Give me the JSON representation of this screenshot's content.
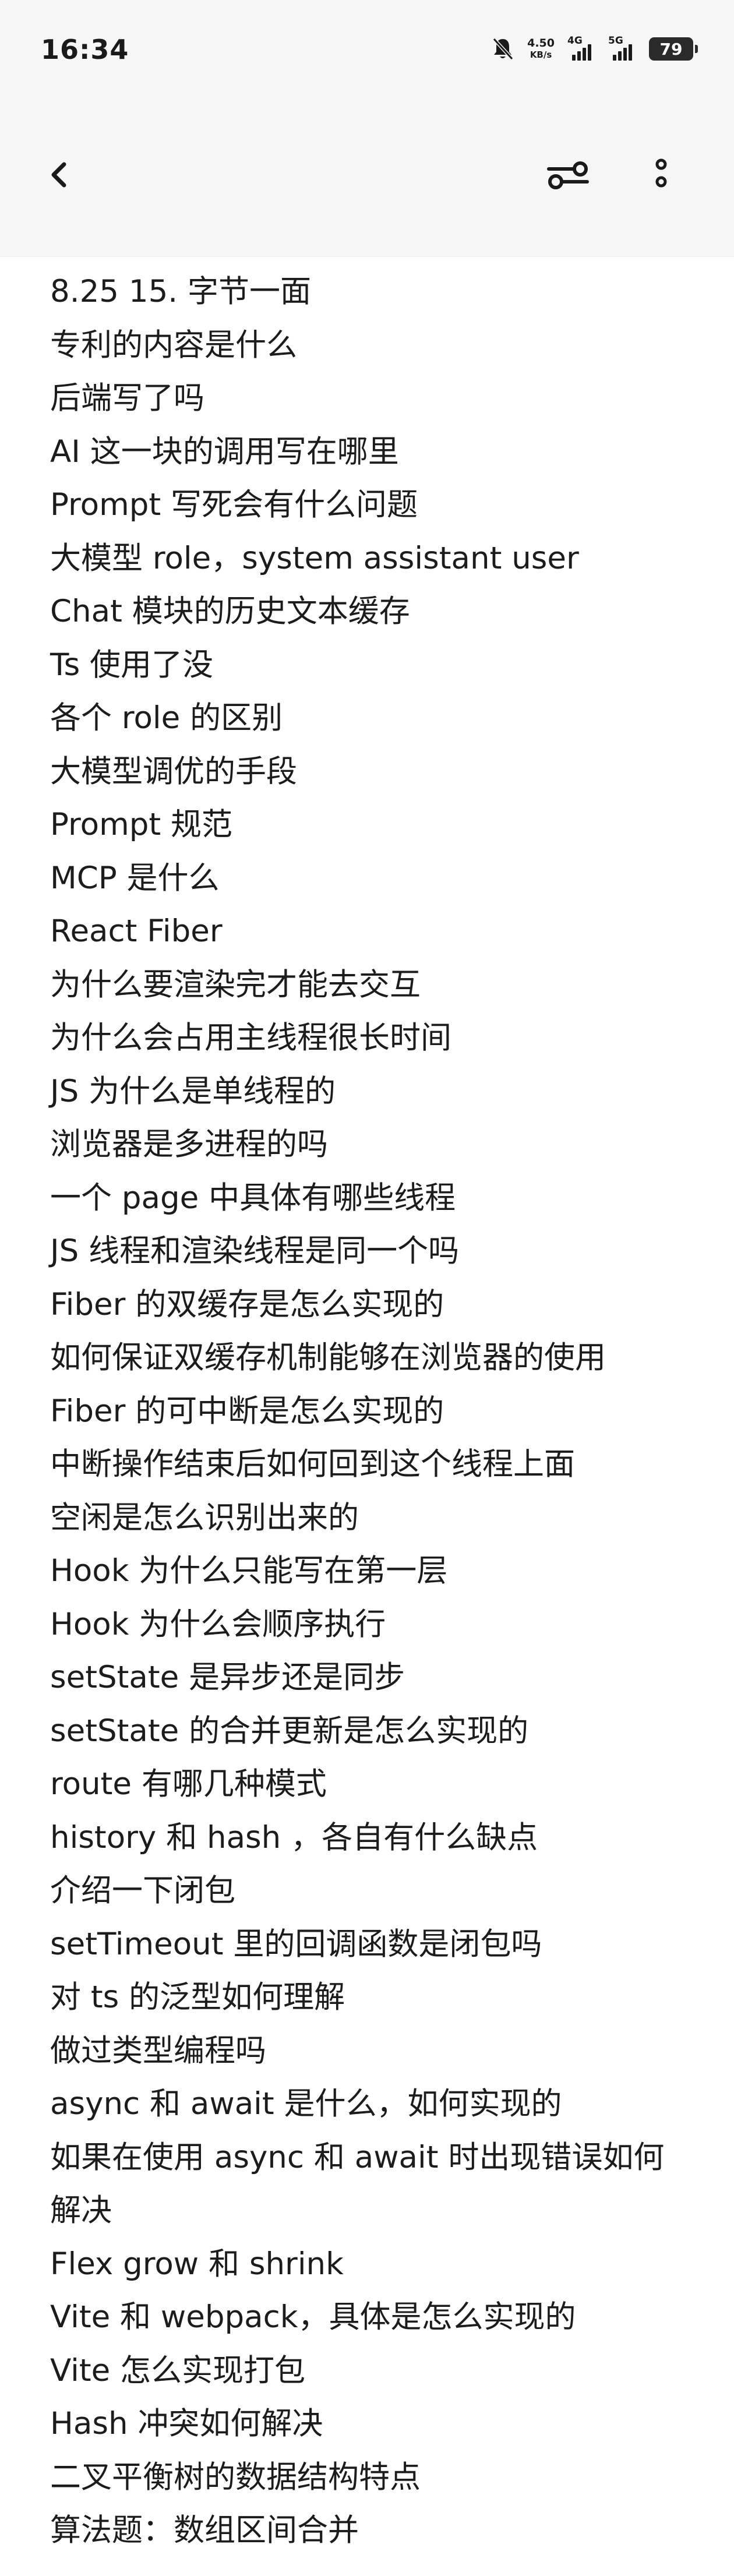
{
  "status_bar": {
    "time": "16:34",
    "speed_value": "4.50",
    "speed_unit": "KB/s",
    "signal_1_label": "4G",
    "signal_2_label": "5G",
    "battery": "79"
  },
  "nav": {
    "back_icon": "chevron-left-icon",
    "filter_icon": "filter-toggle-icon",
    "more_icon": "more-vertical-icon"
  },
  "note": {
    "lines": [
      "8.25 15. 字节一面",
      "专利的内容是什么",
      "后端写了吗",
      "AI 这一块的调用写在哪里",
      "Prompt 写死会有什么问题",
      "大模型 role，system assistant user",
      "Chat 模块的历史文本缓存",
      "Ts 使用了没",
      "各个 role 的区别",
      "大模型调优的手段",
      "Prompt 规范",
      "MCP 是什么",
      "React Fiber",
      "为什么要渲染完才能去交互",
      "为什么会占用主线程很长时间",
      "JS 为什么是单线程的",
      "浏览器是多进程的吗",
      "一个 page 中具体有哪些线程",
      "JS 线程和渲染线程是同一个吗",
      "Fiber 的双缓存是怎么实现的",
      "如何保证双缓存机制能够在浏览器的使用",
      "Fiber 的可中断是怎么实现的",
      "中断操作结束后如何回到这个线程上面",
      "空闲是怎么识别出来的",
      "Hook 为什么只能写在第一层",
      "Hook 为什么会顺序执行",
      "setState 是异步还是同步",
      "setState 的合并更新是怎么实现的",
      "route 有哪几种模式",
      "history 和 hash ，各自有什么缺点",
      "介绍一下闭包",
      "setTimeout 里的回调函数是闭包吗",
      "对 ts 的泛型如何理解",
      "做过类型编程吗",
      "async 和 await 是什么，如何实现的",
      "如果在使用 async 和 await 时出现错误如何",
      "解决",
      "Flex grow 和 shrink",
      "Vite 和 webpack，具体是怎么实现的",
      "Vite 怎么实现打包",
      "Hash 冲突如何解决",
      "二叉平衡树的数据结构特点",
      "算法题：数组区间合并"
    ]
  }
}
